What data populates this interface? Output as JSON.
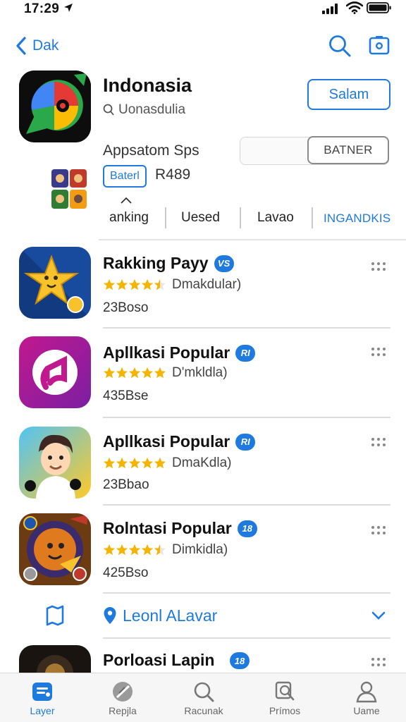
{
  "status_bar": {
    "time": "17:29"
  },
  "nav": {
    "back_label": "Dak"
  },
  "header": {
    "title": "Indonasia",
    "subtitle": "Uonasdulia",
    "action_label": "Salam",
    "section_label": "Appsatom Sps",
    "section_button": "BATNER",
    "pill_label": "Baterl",
    "price": "R489"
  },
  "tabs": [
    "anking",
    "Uesed",
    "Lavao",
    "INGANDKIS"
  ],
  "apps": [
    {
      "name": "Rakking Payy",
      "badge": "VS",
      "stars": 4.5,
      "category": "Dmakdular)",
      "size": "23Boso"
    },
    {
      "name": "Apllkasi Popular",
      "badge": "RI",
      "stars": 5,
      "category": "D'mkldla)",
      "size": "435Bse"
    },
    {
      "name": "Apllkasi Popular",
      "badge": "RI",
      "stars": 5,
      "category": "DmaKdla)",
      "size": "23Bbao"
    },
    {
      "name": "Rolntasi Popular",
      "badge": "18",
      "stars": 4.5,
      "category": "Dimkidla)",
      "size": "425Bso"
    },
    {
      "name": "Porloasi Lapin",
      "badge": "18",
      "stars": 0,
      "category": "",
      "size": ""
    }
  ],
  "location": {
    "label": "Leonl ALavar"
  },
  "tab_bar": [
    {
      "label": "Layer",
      "icon": "layers-icon",
      "active": true
    },
    {
      "label": "Repjla",
      "icon": "compass-icon",
      "active": false
    },
    {
      "label": "Racunak",
      "icon": "search-icon",
      "active": false
    },
    {
      "label": "Prímos",
      "icon": "search-doc-icon",
      "active": false
    },
    {
      "label": "Uame",
      "icon": "person-icon",
      "active": false
    }
  ],
  "colors": {
    "accent": "#1f7ae0",
    "star": "#f5b400",
    "divider": "#dcdcdc"
  }
}
